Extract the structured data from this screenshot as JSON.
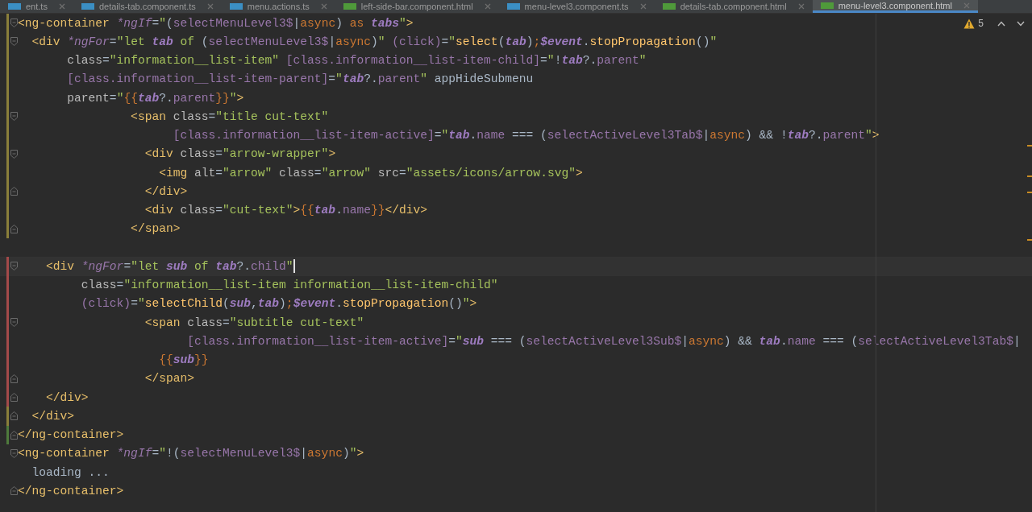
{
  "tabs": [
    {
      "label": "ent.ts",
      "kind": "ts",
      "selected": false
    },
    {
      "label": "details-tab.component.ts",
      "kind": "ts",
      "selected": false
    },
    {
      "label": "menu.actions.ts",
      "kind": "ts",
      "selected": false
    },
    {
      "label": "left-side-bar.component.html",
      "kind": "html",
      "selected": false
    },
    {
      "label": "menu-level3.component.ts",
      "kind": "ts",
      "selected": false
    },
    {
      "label": "details-tab.component.html",
      "kind": "html",
      "selected": false
    },
    {
      "label": "menu-level3.component.html",
      "kind": "html",
      "selected": true
    }
  ],
  "inspections": {
    "warnings": "5"
  },
  "lines": [
    {
      "change_marker": {
        "kind": "modified"
      },
      "fold_marker": {
        "kind": "start"
      },
      "current": false,
      "tokens": [
        {
          "kind": "tag",
          "text": "<ng-container "
        },
        {
          "kind": "dir",
          "text": "*ngIf"
        },
        {
          "kind": "text",
          "text": "="
        },
        {
          "kind": "str",
          "text": "\""
        },
        {
          "kind": "text",
          "text": "("
        },
        {
          "kind": "prop",
          "text": "selectMenuLevel3$"
        },
        {
          "kind": "text",
          "text": "|"
        },
        {
          "kind": "kw",
          "text": "async"
        },
        {
          "kind": "text",
          "text": ") "
        },
        {
          "kind": "kw",
          "text": "as "
        },
        {
          "kind": "var",
          "text": "tabs"
        },
        {
          "kind": "str",
          "text": "\""
        },
        {
          "kind": "tag",
          "text": ">"
        }
      ]
    },
    {
      "change_marker": {
        "kind": "modified"
      },
      "fold_marker": {
        "kind": "start"
      },
      "current": false,
      "tokens": [
        {
          "kind": "tag",
          "text": "  <div "
        },
        {
          "kind": "dir",
          "text": "*ngFor"
        },
        {
          "kind": "text",
          "text": "="
        },
        {
          "kind": "str",
          "text": "\"let "
        },
        {
          "kind": "var",
          "text": "tab"
        },
        {
          "kind": "str",
          "text": " of "
        },
        {
          "kind": "text",
          "text": "("
        },
        {
          "kind": "prop",
          "text": "selectMenuLevel3$"
        },
        {
          "kind": "text",
          "text": "|"
        },
        {
          "kind": "kw",
          "text": "async"
        },
        {
          "kind": "text",
          "text": ")"
        },
        {
          "kind": "str",
          "text": "\" "
        },
        {
          "kind": "prop",
          "text": "(click)"
        },
        {
          "kind": "text",
          "text": "="
        },
        {
          "kind": "str",
          "text": "\""
        },
        {
          "kind": "fn",
          "text": "select"
        },
        {
          "kind": "text",
          "text": "("
        },
        {
          "kind": "var",
          "text": "tab"
        },
        {
          "kind": "text",
          "text": ")"
        },
        {
          "kind": "kw",
          "text": ";"
        },
        {
          "kind": "var",
          "text": "$event"
        },
        {
          "kind": "text",
          "text": "."
        },
        {
          "kind": "fn",
          "text": "stopPropagation"
        },
        {
          "kind": "text",
          "text": "()"
        },
        {
          "kind": "str",
          "text": "\""
        }
      ]
    },
    {
      "change_marker": {
        "kind": "modified"
      },
      "current": false,
      "tokens": [
        {
          "kind": "attr",
          "text": "       class"
        },
        {
          "kind": "text",
          "text": "="
        },
        {
          "kind": "str",
          "text": "\"information__list-item\" "
        },
        {
          "kind": "prop",
          "text": "[class.information__list-item-child]"
        },
        {
          "kind": "text",
          "text": "="
        },
        {
          "kind": "str",
          "text": "\""
        },
        {
          "kind": "text",
          "text": "!"
        },
        {
          "kind": "var",
          "text": "tab"
        },
        {
          "kind": "text",
          "text": "?."
        },
        {
          "kind": "prop",
          "text": "parent"
        },
        {
          "kind": "str",
          "text": "\""
        }
      ]
    },
    {
      "change_marker": {
        "kind": "modified"
      },
      "current": false,
      "tokens": [
        {
          "kind": "prop",
          "text": "       [class.information__list-item-parent]"
        },
        {
          "kind": "text",
          "text": "="
        },
        {
          "kind": "str",
          "text": "\""
        },
        {
          "kind": "var",
          "text": "tab"
        },
        {
          "kind": "text",
          "text": "?."
        },
        {
          "kind": "prop",
          "text": "parent"
        },
        {
          "kind": "str",
          "text": "\""
        },
        {
          "kind": "text",
          "text": " appHideSubmenu"
        }
      ]
    },
    {
      "change_marker": {
        "kind": "modified"
      },
      "current": false,
      "tokens": [
        {
          "kind": "attr",
          "text": "       parent"
        },
        {
          "kind": "text",
          "text": "="
        },
        {
          "kind": "str",
          "text": "\""
        },
        {
          "kind": "kw",
          "text": "{{"
        },
        {
          "kind": "var",
          "text": "tab"
        },
        {
          "kind": "text",
          "text": "?."
        },
        {
          "kind": "prop",
          "text": "parent"
        },
        {
          "kind": "kw",
          "text": "}}"
        },
        {
          "kind": "str",
          "text": "\""
        },
        {
          "kind": "tag",
          "text": ">"
        }
      ]
    },
    {
      "change_marker": {
        "kind": "modified"
      },
      "fold_marker": {
        "kind": "start"
      },
      "current": false,
      "tokens": [
        {
          "kind": "tag",
          "text": "                <span "
        },
        {
          "kind": "attr",
          "text": "class"
        },
        {
          "kind": "text",
          "text": "="
        },
        {
          "kind": "str",
          "text": "\"title cut-text\""
        }
      ]
    },
    {
      "change_marker": {
        "kind": "modified"
      },
      "current": false,
      "tokens": [
        {
          "kind": "prop",
          "text": "                      [class.information__list-item-active]"
        },
        {
          "kind": "text",
          "text": "="
        },
        {
          "kind": "str",
          "text": "\""
        },
        {
          "kind": "var",
          "text": "tab"
        },
        {
          "kind": "text",
          "text": "."
        },
        {
          "kind": "prop",
          "text": "name"
        },
        {
          "kind": "text",
          "text": " === ("
        },
        {
          "kind": "prop",
          "text": "selectActiveLevel3Tab$"
        },
        {
          "kind": "text",
          "text": "|"
        },
        {
          "kind": "kw",
          "text": "async"
        },
        {
          "kind": "text",
          "text": ") && !"
        },
        {
          "kind": "var",
          "text": "tab"
        },
        {
          "kind": "text",
          "text": "?."
        },
        {
          "kind": "prop",
          "text": "parent"
        },
        {
          "kind": "str",
          "text": "\""
        },
        {
          "kind": "tag",
          "text": ">"
        }
      ]
    },
    {
      "change_marker": {
        "kind": "modified"
      },
      "fold_marker": {
        "kind": "start"
      },
      "current": false,
      "tokens": [
        {
          "kind": "tag",
          "text": "                  <div "
        },
        {
          "kind": "attr",
          "text": "class"
        },
        {
          "kind": "text",
          "text": "="
        },
        {
          "kind": "str",
          "text": "\"arrow-wrapper\""
        },
        {
          "kind": "tag",
          "text": ">"
        }
      ]
    },
    {
      "change_marker": {
        "kind": "modified"
      },
      "current": false,
      "tokens": [
        {
          "kind": "tag",
          "text": "                    <img "
        },
        {
          "kind": "attr",
          "text": "alt"
        },
        {
          "kind": "text",
          "text": "="
        },
        {
          "kind": "str",
          "text": "\"arrow\" "
        },
        {
          "kind": "attr",
          "text": "class"
        },
        {
          "kind": "text",
          "text": "="
        },
        {
          "kind": "str",
          "text": "\"arrow\" "
        },
        {
          "kind": "attr",
          "text": "src"
        },
        {
          "kind": "text",
          "text": "="
        },
        {
          "kind": "str",
          "text": "\"assets/icons/arrow.svg\""
        },
        {
          "kind": "tag",
          "text": ">"
        }
      ]
    },
    {
      "change_marker": {
        "kind": "modified"
      },
      "fold_marker": {
        "kind": "end"
      },
      "current": false,
      "tokens": [
        {
          "kind": "tag",
          "text": "                  </div>"
        }
      ]
    },
    {
      "change_marker": {
        "kind": "modified"
      },
      "current": false,
      "tokens": [
        {
          "kind": "tag",
          "text": "                  <div "
        },
        {
          "kind": "attr",
          "text": "class"
        },
        {
          "kind": "text",
          "text": "="
        },
        {
          "kind": "str",
          "text": "\"cut-text\""
        },
        {
          "kind": "tag",
          "text": ">"
        },
        {
          "kind": "kw",
          "text": "{{"
        },
        {
          "kind": "var",
          "text": "tab"
        },
        {
          "kind": "text",
          "text": "."
        },
        {
          "kind": "prop",
          "text": "name"
        },
        {
          "kind": "kw",
          "text": "}}"
        },
        {
          "kind": "tag",
          "text": "</div>"
        }
      ]
    },
    {
      "change_marker": {
        "kind": "modified"
      },
      "fold_marker": {
        "kind": "end"
      },
      "current": false,
      "tokens": [
        {
          "kind": "tag",
          "text": "                </span>"
        }
      ]
    },
    {
      "current": false
    },
    {
      "change_marker": {
        "kind": "deleted"
      },
      "fold_marker": {
        "kind": "start"
      },
      "current": true,
      "tokens": [
        {
          "kind": "tag",
          "text": "    <div "
        },
        {
          "kind": "dir",
          "text": "*ngFor"
        },
        {
          "kind": "text",
          "text": "="
        },
        {
          "kind": "str",
          "text": "\"let "
        },
        {
          "kind": "var",
          "text": "sub"
        },
        {
          "kind": "str",
          "text": " of "
        },
        {
          "kind": "var",
          "text": "tab"
        },
        {
          "kind": "text",
          "text": "?."
        },
        {
          "kind": "prop",
          "text": "child"
        },
        {
          "kind": "str",
          "text": "\""
        }
      ]
    },
    {
      "change_marker": {
        "kind": "deleted"
      },
      "current": false,
      "tokens": [
        {
          "kind": "attr",
          "text": "         class"
        },
        {
          "kind": "text",
          "text": "="
        },
        {
          "kind": "str",
          "text": "\"information__list-item information__list-item-child\""
        }
      ]
    },
    {
      "change_marker": {
        "kind": "deleted"
      },
      "current": false,
      "tokens": [
        {
          "kind": "prop",
          "text": "         (click)"
        },
        {
          "kind": "text",
          "text": "="
        },
        {
          "kind": "str",
          "text": "\""
        },
        {
          "kind": "fn",
          "text": "selectChild"
        },
        {
          "kind": "text",
          "text": "("
        },
        {
          "kind": "var",
          "text": "sub"
        },
        {
          "kind": "text",
          "text": ","
        },
        {
          "kind": "var",
          "text": "tab"
        },
        {
          "kind": "text",
          "text": ")"
        },
        {
          "kind": "kw",
          "text": ";"
        },
        {
          "kind": "var",
          "text": "$event"
        },
        {
          "kind": "text",
          "text": "."
        },
        {
          "kind": "fn",
          "text": "stopPropagation"
        },
        {
          "kind": "text",
          "text": "()"
        },
        {
          "kind": "str",
          "text": "\""
        },
        {
          "kind": "tag",
          "text": ">"
        }
      ]
    },
    {
      "change_marker": {
        "kind": "deleted"
      },
      "fold_marker": {
        "kind": "start"
      },
      "current": false,
      "tokens": [
        {
          "kind": "tag",
          "text": "                  <span "
        },
        {
          "kind": "attr",
          "text": "class"
        },
        {
          "kind": "text",
          "text": "="
        },
        {
          "kind": "str",
          "text": "\"subtitle cut-text\""
        }
      ]
    },
    {
      "change_marker": {
        "kind": "deleted"
      },
      "current": false,
      "tokens": [
        {
          "kind": "prop",
          "text": "                        [class.information__list-item-active]"
        },
        {
          "kind": "text",
          "text": "="
        },
        {
          "kind": "str",
          "text": "\""
        },
        {
          "kind": "var",
          "text": "sub"
        },
        {
          "kind": "text",
          "text": " === ("
        },
        {
          "kind": "prop",
          "text": "selectActiveLevel3Sub$"
        },
        {
          "kind": "text",
          "text": "|"
        },
        {
          "kind": "kw",
          "text": "async"
        },
        {
          "kind": "text",
          "text": ") && "
        },
        {
          "kind": "var",
          "text": "tab"
        },
        {
          "kind": "text",
          "text": "."
        },
        {
          "kind": "prop",
          "text": "name"
        },
        {
          "kind": "text",
          "text": " === ("
        },
        {
          "kind": "prop",
          "text": "selectActiveLevel3Tab$"
        },
        {
          "kind": "text",
          "text": "|"
        }
      ]
    },
    {
      "change_marker": {
        "kind": "deleted"
      },
      "current": false,
      "tokens": [
        {
          "kind": "kw",
          "text": "                    {{"
        },
        {
          "kind": "var",
          "text": "sub"
        },
        {
          "kind": "kw",
          "text": "}}"
        }
      ]
    },
    {
      "change_marker": {
        "kind": "deleted"
      },
      "fold_marker": {
        "kind": "end"
      },
      "current": false,
      "tokens": [
        {
          "kind": "tag",
          "text": "                  </span>"
        }
      ]
    },
    {
      "change_marker": {
        "kind": "deleted"
      },
      "fold_marker": {
        "kind": "end"
      },
      "current": false,
      "tokens": [
        {
          "kind": "tag",
          "text": "    </div>"
        }
      ]
    },
    {
      "change_marker": {
        "kind": "modified"
      },
      "fold_marker": {
        "kind": "end"
      },
      "current": false,
      "tokens": [
        {
          "kind": "tag",
          "text": "  </div>"
        }
      ]
    },
    {
      "change_marker": {
        "kind": "added"
      },
      "fold_marker": {
        "kind": "end"
      },
      "current": false,
      "tokens": [
        {
          "kind": "tag",
          "text": "</ng-container>"
        }
      ]
    },
    {
      "fold_marker": {
        "kind": "start"
      },
      "current": false,
      "tokens": [
        {
          "kind": "tag",
          "text": "<ng-container "
        },
        {
          "kind": "dir",
          "text": "*ngIf"
        },
        {
          "kind": "text",
          "text": "="
        },
        {
          "kind": "str",
          "text": "\""
        },
        {
          "kind": "text",
          "text": "!("
        },
        {
          "kind": "prop",
          "text": "selectMenuLevel3$"
        },
        {
          "kind": "text",
          "text": "|"
        },
        {
          "kind": "kw",
          "text": "async"
        },
        {
          "kind": "text",
          "text": ")"
        },
        {
          "kind": "str",
          "text": "\""
        },
        {
          "kind": "tag",
          "text": ">"
        }
      ]
    },
    {
      "current": false,
      "tokens": [
        {
          "kind": "text",
          "text": "  loading ..."
        }
      ]
    },
    {
      "fold_marker": {
        "kind": "end"
      },
      "current": false,
      "tokens": [
        {
          "kind": "tag",
          "text": "</ng-container>"
        }
      ]
    }
  ]
}
